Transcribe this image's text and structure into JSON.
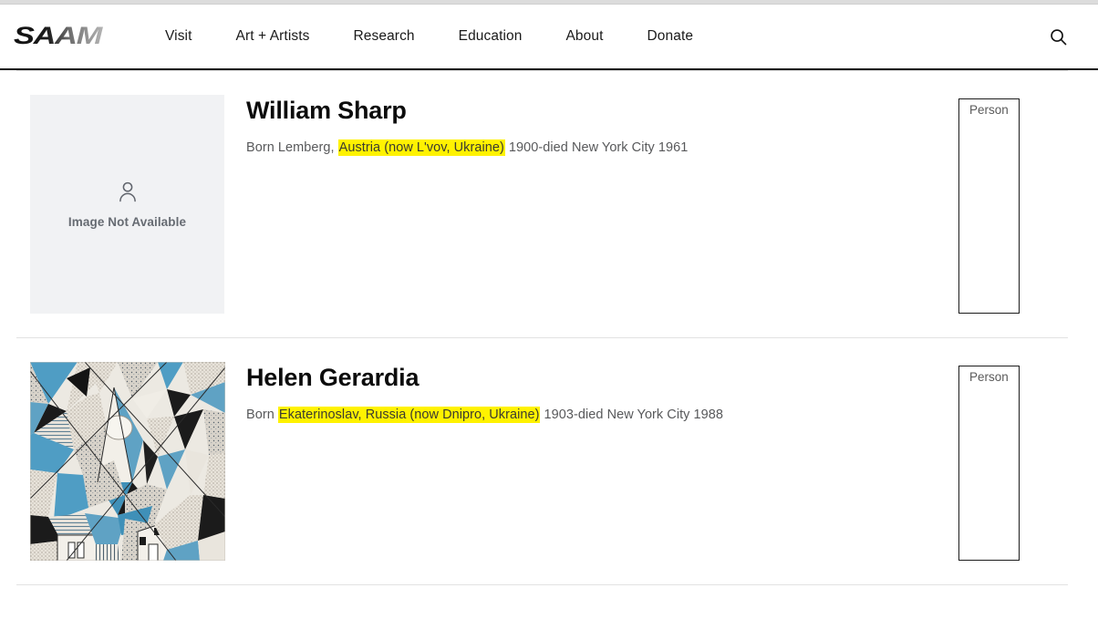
{
  "site": {
    "logo_text": "SAAM",
    "logo_name": "saam-logo"
  },
  "header": {
    "nav": [
      {
        "label": "Visit",
        "name": "nav-visit"
      },
      {
        "label": "Art + Artists",
        "name": "nav-art-artists"
      },
      {
        "label": "Research",
        "name": "nav-research"
      },
      {
        "label": "Education",
        "name": "nav-education"
      },
      {
        "label": "About",
        "name": "nav-about"
      },
      {
        "label": "Donate",
        "name": "nav-donate"
      }
    ],
    "search_icon": "search-icon",
    "search_label": "Search"
  },
  "results": [
    {
      "name": "William Sharp",
      "badge": "Person",
      "thumb_type": "placeholder",
      "placeholder_label": "Image Not Available",
      "placeholder_icon": "person-icon",
      "desc_before": "Born Lemberg, ",
      "desc_highlight": "Austria (now L'vov, Ukraine)",
      "desc_after": " 1900-died New York City 1961"
    },
    {
      "name": "Helen Gerardia",
      "badge": "Person",
      "thumb_type": "artwork",
      "artwork_alt": "abstract cubist print in blue, black and white",
      "desc_before": "Born ",
      "desc_highlight": "Ekaterinoslav, Russia (now Dnipro, Ukraine)",
      "desc_after": " 1903-died New York City 1988"
    }
  ],
  "colors": {
    "highlight": "#fff200",
    "header_border": "#111111",
    "placeholder_bg": "#f1f2f4",
    "text_muted": "#58595b"
  }
}
